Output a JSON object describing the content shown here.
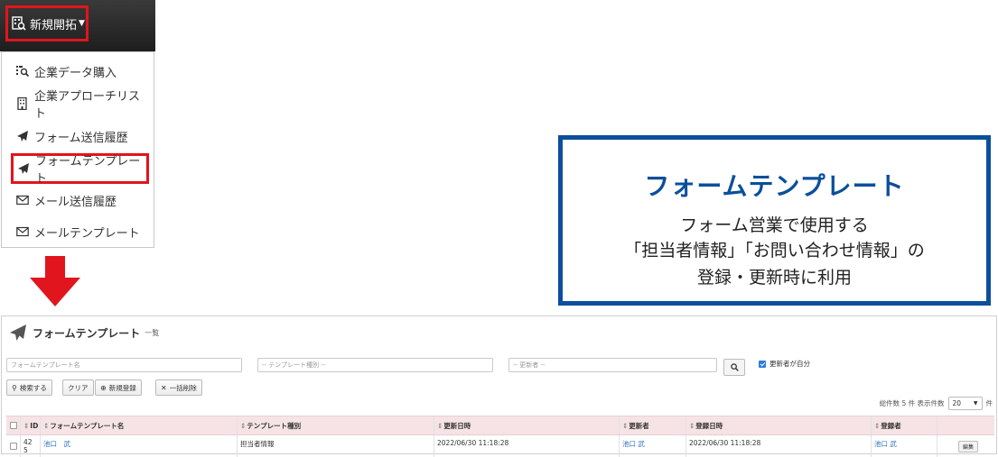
{
  "nav": {
    "button_label": "新規開拓",
    "menu": [
      {
        "label": "企業データ購入",
        "icon": "list-search-icon"
      },
      {
        "label": "企業アプローチリスト",
        "icon": "building-icon"
      },
      {
        "label": "フォーム送信履歴",
        "icon": "paper-plane-icon"
      },
      {
        "label": "フォームテンプレート",
        "icon": "paper-plane-icon"
      },
      {
        "label": "メール送信履歴",
        "icon": "envelope-icon"
      },
      {
        "label": "メールテンプレート",
        "icon": "envelope-icon"
      }
    ]
  },
  "callout": {
    "title": "フォームテンプレート",
    "line1": "フォーム営業で使用する",
    "line2": "「担当者情報」「お問い合わせ情報」の",
    "line3": "登録・更新時に利用",
    "color": "#0b4f9c"
  },
  "screen": {
    "title": "フォームテンプレート",
    "subtitle": "一覧",
    "filters": {
      "name_placeholder": "フォームテンプレート名",
      "type_placeholder": "-- テンプレート種別 --",
      "updater_placeholder": "-- 更新者 --",
      "self_label": "更新者が自分"
    },
    "buttons": {
      "search": "検索する",
      "clear": "クリア",
      "new": "新規登録",
      "bulk_delete": "一括削除"
    },
    "total": {
      "count_label": "総件数 5 件 表示件数",
      "page_size": "20",
      "unit": "件"
    },
    "headers": {
      "id": "ID",
      "name": "フォームテンプレート名",
      "type": "テンプレート種別",
      "updated_at": "更新日時",
      "updater": "更新者",
      "created_at": "登録日時",
      "creator": "登録者"
    },
    "row": {
      "id_line1": "42",
      "id_line2": "5",
      "name": "池口　武",
      "type": "担当者情報",
      "updated_at": "2022/06/30 11:18:28",
      "updater": "池口 武",
      "created_at": "2022/06/30 11:18:28",
      "creator": "池口 武",
      "edit": "編集"
    }
  },
  "colors": {
    "highlight_red": "#e0151d",
    "header_pink": "#f6e3e6",
    "link_blue": "#2a6ebd"
  }
}
